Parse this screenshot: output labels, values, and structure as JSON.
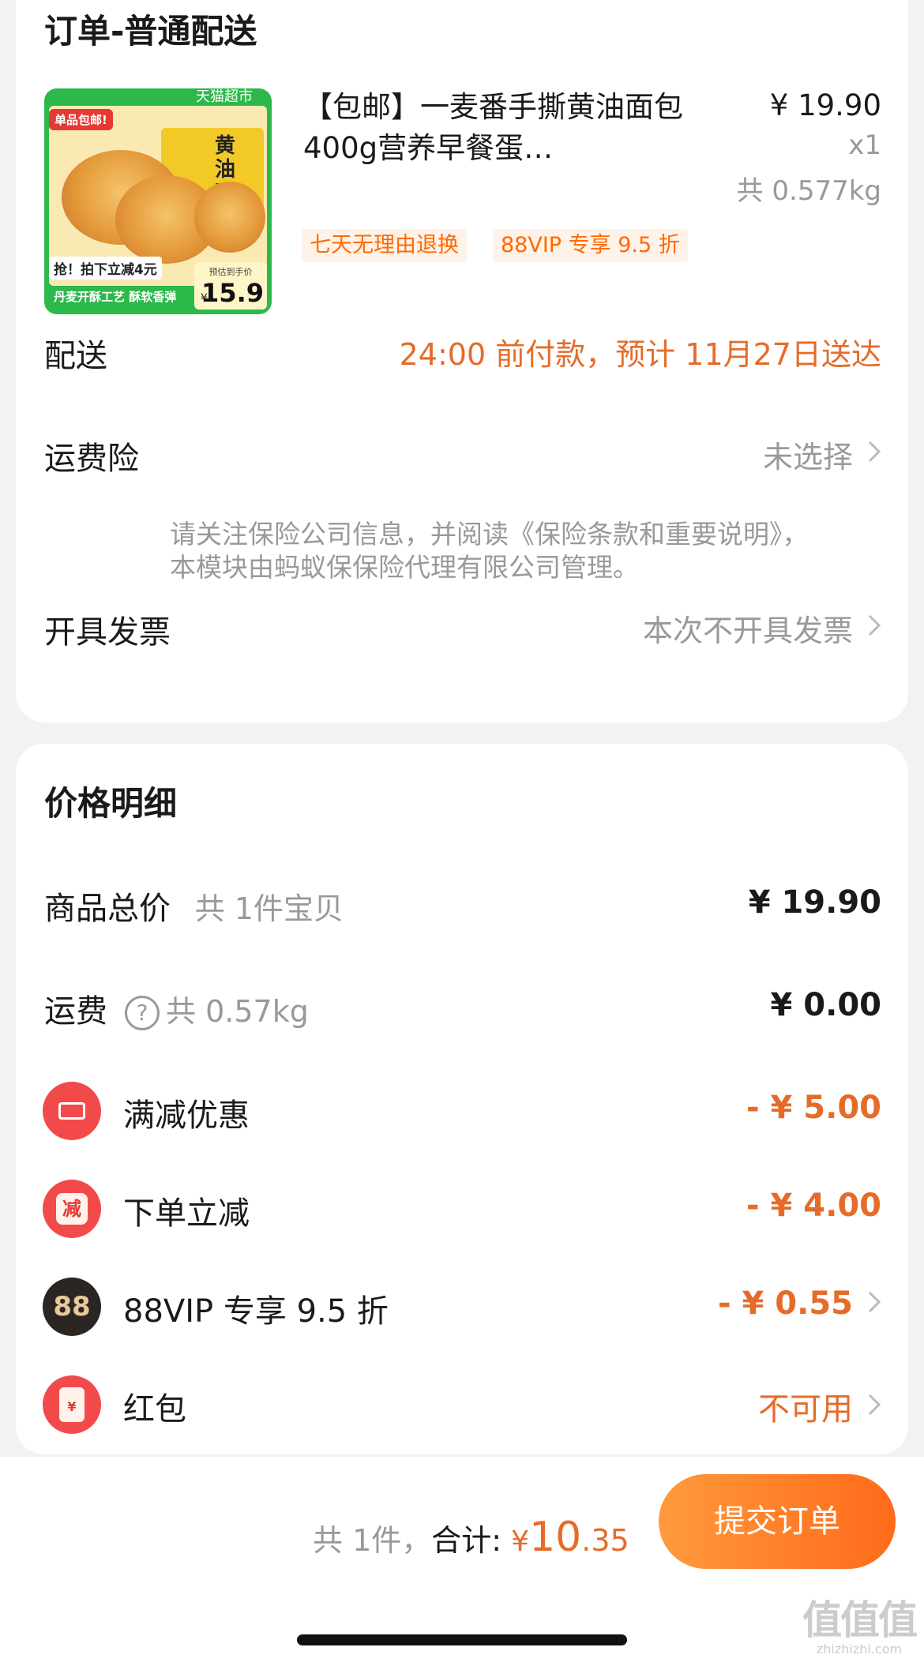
{
  "order": {
    "title": "订单-普通配送",
    "product": {
      "image": {
        "store": "天猫超市",
        "badge": "单品包邮!",
        "box_text": "黄油面包",
        "promo": "抢！拍下立减4元",
        "craft": "丹麦开酥工艺 酥软香弹",
        "price_label": "预估到手价",
        "price_currency": "¥",
        "price": "15.9"
      },
      "name": "【包邮】一麦番手撕黄油面包400g营养早餐蛋…",
      "price": "¥ 19.90",
      "qty": "x1",
      "weight": "共 0.577kg",
      "tags": [
        "七天无理由退换",
        "88VIP 专享 9.5 折"
      ]
    },
    "delivery": {
      "label": "配送",
      "value": "24:00 前付款，预计 11月27日送达"
    },
    "insurance": {
      "label": "运费险",
      "value": "未选择",
      "note": "请关注保险公司信息，并阅读《保险条款和重要说明》，本模块由蚂蚁保保险代理有限公司管理。"
    },
    "invoice": {
      "label": "开具发票",
      "value": "本次不开具发票"
    }
  },
  "price": {
    "title": "价格明细",
    "items_total": {
      "label": "商品总价",
      "sub": "共 1件宝贝",
      "value": "¥ 19.90"
    },
    "shipping": {
      "label": "运费",
      "help": "?",
      "sub": "共 0.57kg",
      "value": "¥ 0.00"
    },
    "discount_full": {
      "label": "满减优惠",
      "value": "- ¥ 5.00"
    },
    "discount_order": {
      "label": "下单立减",
      "icon_text": "减",
      "value": "- ¥ 4.00"
    },
    "vip": {
      "label": "88VIP 专享 9.5 折",
      "icon_text": "88",
      "value": "- ¥ 0.55"
    },
    "redpacket": {
      "label": "红包",
      "icon_text": "¥",
      "value": "不可用"
    }
  },
  "bottom": {
    "count": "共 1件，",
    "total_label": "合计:",
    "currency": "¥",
    "amount_int": "10",
    "amount_dec": ".35",
    "submit": "提交订单"
  },
  "watermark": {
    "big": "值值值",
    "small": "zhizhizhi.com"
  }
}
